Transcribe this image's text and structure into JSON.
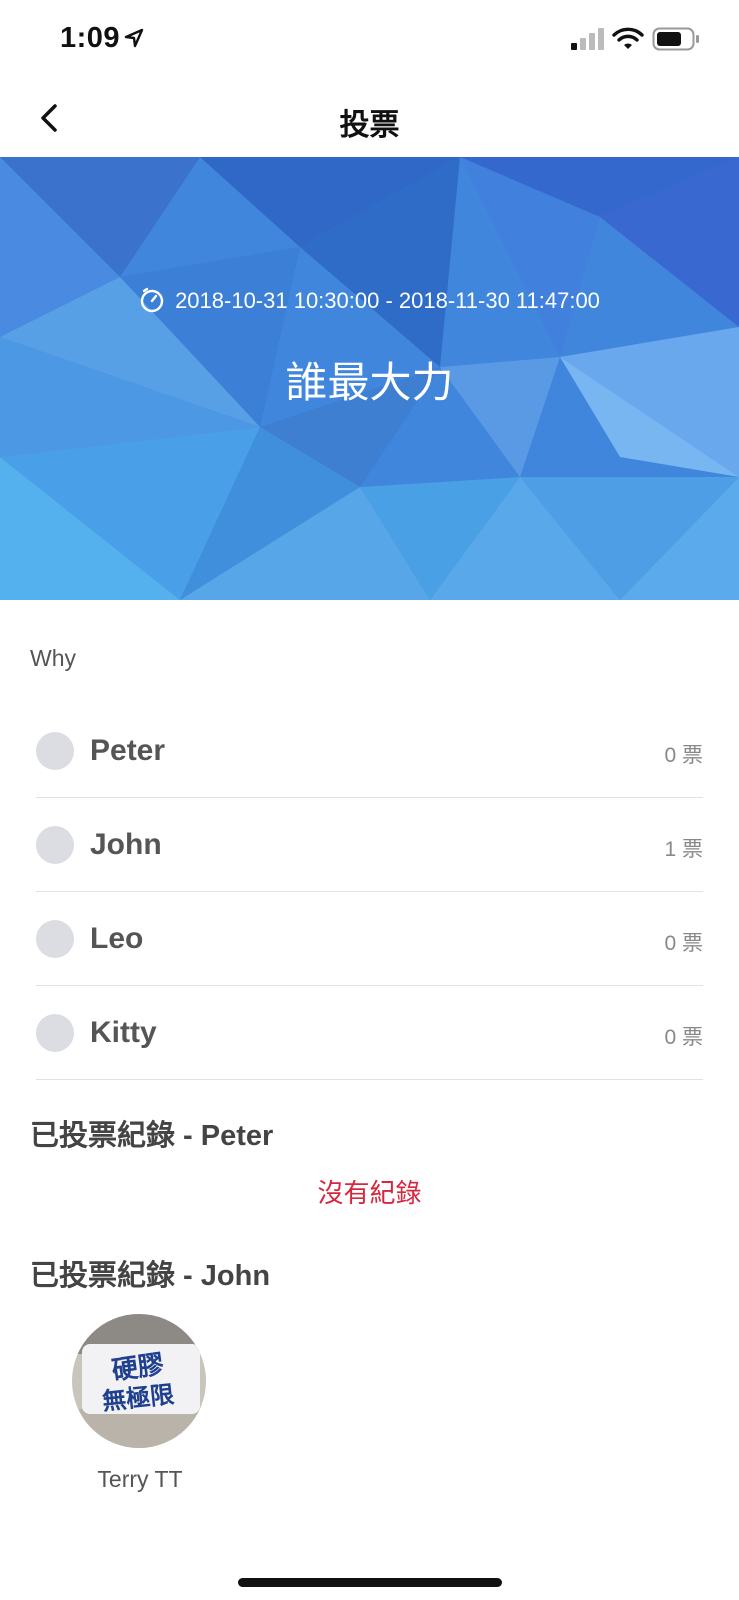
{
  "status": {
    "time": "1:09"
  },
  "nav": {
    "title": "投票"
  },
  "banner": {
    "date_range": "2018-10-31 10:30:00 - 2018-11-30 11:47:00",
    "title": "誰最大力"
  },
  "question": "Why",
  "options": [
    {
      "label": "Peter",
      "votes": "0 票"
    },
    {
      "label": "John",
      "votes": "1 票"
    },
    {
      "label": "Leo",
      "votes": "0 票"
    },
    {
      "label": "Kitty",
      "votes": "0 票"
    }
  ],
  "records": [
    {
      "title": "已投票紀錄 - Peter",
      "empty_text": "沒有紀錄"
    },
    {
      "title": "已投票紀錄 - John",
      "voters": [
        {
          "name": "Terry TT",
          "avatar_text": "硬膠無極限"
        }
      ]
    }
  ],
  "colors": {
    "accent_red": "#d7263d",
    "banner_blue": "#3f86dc",
    "radio_gray": "#dcdce3"
  }
}
